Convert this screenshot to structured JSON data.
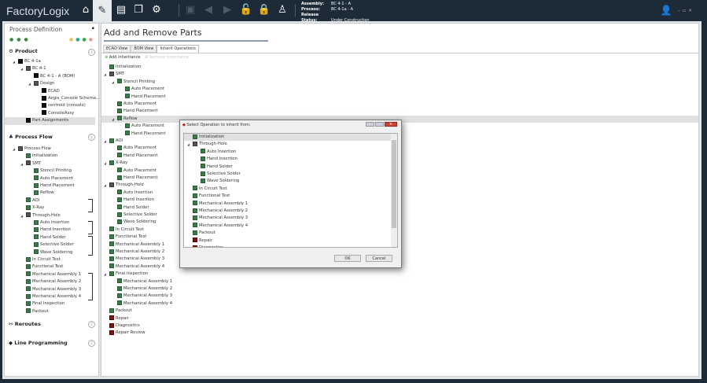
{
  "app": {
    "logo": "FactoryLogix",
    "info": [
      {
        "label": "Assembly:",
        "value": "BC 4-1 - A"
      },
      {
        "label": "Process:",
        "value": "BC 4-1a - A"
      },
      {
        "label": "Release Status:",
        "value": "Under Construction"
      }
    ],
    "toolbar": [
      "home-icon",
      "edit-icon",
      "document-icon",
      "copy-icon",
      "gear-icon",
      "save-icon",
      "back-icon",
      "forward-icon",
      "unlock-icon",
      "lock-icon",
      "hierarchy-icon"
    ]
  },
  "left": {
    "title": "Process Definition",
    "pin": "▪",
    "product": {
      "label": "Product",
      "tree": [
        {
          "t": "BC 4-1a",
          "l": 0,
          "e": 1,
          "i": "k"
        },
        {
          "t": "BC 4-1",
          "l": 1,
          "e": 1,
          "i": "f"
        },
        {
          "t": "BC 4-1 - A (BOM)",
          "l": 2,
          "i": "k"
        },
        {
          "t": "Design",
          "l": 2,
          "e": 1,
          "i": "f"
        },
        {
          "t": "ECAD",
          "l": 3,
          "i": "k"
        },
        {
          "t": "Aegis_Console Schema...",
          "l": 3,
          "i": "k"
        },
        {
          "t": "centroid (console)",
          "l": 3,
          "i": "k"
        },
        {
          "t": "ConsoleAssy",
          "l": 3,
          "i": "k"
        },
        {
          "t": "Part Assignments",
          "l": 1,
          "i": "k",
          "sel": 1
        }
      ]
    },
    "process_flow": {
      "label": "Process Flow",
      "tree": [
        {
          "t": "Process Flow",
          "l": 0,
          "e": 1,
          "i": "f"
        },
        {
          "t": "Initialization",
          "l": 1
        },
        {
          "t": "SMT",
          "l": 1,
          "e": 1,
          "i": "f"
        },
        {
          "t": "Stencil Printing",
          "l": 2
        },
        {
          "t": "Auto Placement",
          "l": 2
        },
        {
          "t": "Hand Placement",
          "l": 2
        },
        {
          "t": "Reflow",
          "l": 2
        },
        {
          "t": "AOI",
          "l": 1
        },
        {
          "t": "X-Ray",
          "l": 1
        },
        {
          "t": "Through-Hole",
          "l": 1,
          "e": 1,
          "i": "f"
        },
        {
          "t": "Auto Insertion",
          "l": 2
        },
        {
          "t": "Hand Insertion",
          "l": 2
        },
        {
          "t": "Hand Solder",
          "l": 2
        },
        {
          "t": "Selective Solder",
          "l": 2
        },
        {
          "t": "Wave Soldering",
          "l": 2
        },
        {
          "t": "In Circuit Test",
          "l": 1
        },
        {
          "t": "Functional Test",
          "l": 1
        },
        {
          "t": "Mechanical Assembly 1",
          "l": 1
        },
        {
          "t": "Mechanical Assembly 2",
          "l": 1
        },
        {
          "t": "Mechanical Assembly 3",
          "l": 1
        },
        {
          "t": "Mechanical Assembly 4",
          "l": 1
        },
        {
          "t": "Final Inspection",
          "l": 1
        },
        {
          "t": "Packout",
          "l": 1
        }
      ]
    },
    "reroutes": "Reroutes",
    "line_programming": "Line Programming"
  },
  "main": {
    "title": "Add and Remove Parts",
    "tabs": [
      "ECAD View",
      "BOM View",
      "Inherit Operations"
    ],
    "active_tab": 2,
    "add_inheritance": "Add Inheritance",
    "remove_inheritance": "Remove Inheritance",
    "tree": [
      {
        "t": "Initialization",
        "l": 0
      },
      {
        "t": "SMT",
        "l": 0,
        "e": 1,
        "i": "f"
      },
      {
        "t": "Stencil Printing",
        "l": 1,
        "e": 1
      },
      {
        "t": "Auto Placement",
        "l": 2
      },
      {
        "t": "Hand Placement",
        "l": 2
      },
      {
        "t": "Auto Placement",
        "l": 1
      },
      {
        "t": "Hand Placement",
        "l": 1
      },
      {
        "t": "Reflow",
        "l": 1,
        "e": 1,
        "sel": 1
      },
      {
        "t": "Auto Placement",
        "l": 2
      },
      {
        "t": "Hand Placement",
        "l": 2
      },
      {
        "t": "AOI",
        "l": 0,
        "e": 1
      },
      {
        "t": "Auto Placement",
        "l": 1
      },
      {
        "t": "Hand Placement",
        "l": 1
      },
      {
        "t": "X-Ray",
        "l": 0,
        "e": 1
      },
      {
        "t": "Auto Placement",
        "l": 1
      },
      {
        "t": "Hand Placement",
        "l": 1
      },
      {
        "t": "Through-Hole",
        "l": 0,
        "e": 1,
        "i": "f"
      },
      {
        "t": "Auto Insertion",
        "l": 1
      },
      {
        "t": "Hand Insertion",
        "l": 1
      },
      {
        "t": "Hand Solder",
        "l": 1
      },
      {
        "t": "Selective Solder",
        "l": 1
      },
      {
        "t": "Wave Soldering",
        "l": 1
      },
      {
        "t": "In Circuit Test",
        "l": 0
      },
      {
        "t": "Functional Test",
        "l": 0
      },
      {
        "t": "Mechanical Assembly 1",
        "l": 0
      },
      {
        "t": "Mechanical Assembly 2",
        "l": 0
      },
      {
        "t": "Mechanical Assembly 3",
        "l": 0
      },
      {
        "t": "Mechanical Assembly 4",
        "l": 0
      },
      {
        "t": "Final Inspection",
        "l": 0,
        "e": 1
      },
      {
        "t": "Mechanical Assembly 1",
        "l": 1
      },
      {
        "t": "Mechanical Assembly 2",
        "l": 1
      },
      {
        "t": "Mechanical Assembly 3",
        "l": 1
      },
      {
        "t": "Mechanical Assembly 4",
        "l": 1
      },
      {
        "t": "Packout",
        "l": 0
      },
      {
        "t": "Repair",
        "l": 0,
        "i": "r"
      },
      {
        "t": "Diagnostics",
        "l": 0,
        "i": "r"
      },
      {
        "t": "Repair Review",
        "l": 0,
        "i": "r"
      }
    ]
  },
  "dialog": {
    "title": "Select Operation to inherit from:",
    "ok": "OK",
    "cancel": "Cancel",
    "tree": [
      {
        "t": "Initialization",
        "l": 0,
        "sel": 1
      },
      {
        "t": "Through-Hole",
        "l": 0,
        "e": 1,
        "i": "f"
      },
      {
        "t": "Auto Insertion",
        "l": 1
      },
      {
        "t": "Hand Insertion",
        "l": 1
      },
      {
        "t": "Hand Solder",
        "l": 1
      },
      {
        "t": "Selective Solder",
        "l": 1
      },
      {
        "t": "Wave Soldering",
        "l": 1
      },
      {
        "t": "In Circuit Test",
        "l": 0
      },
      {
        "t": "Functional Test",
        "l": 0
      },
      {
        "t": "Mechanical Assembly 1",
        "l": 0
      },
      {
        "t": "Mechanical Assembly 2",
        "l": 0
      },
      {
        "t": "Mechanical Assembly 3",
        "l": 0
      },
      {
        "t": "Mechanical Assembly 4",
        "l": 0
      },
      {
        "t": "Packout",
        "l": 0
      },
      {
        "t": "Repair",
        "l": 0,
        "i": "r"
      },
      {
        "t": "Diagnostics",
        "l": 0,
        "i": "r"
      }
    ]
  }
}
